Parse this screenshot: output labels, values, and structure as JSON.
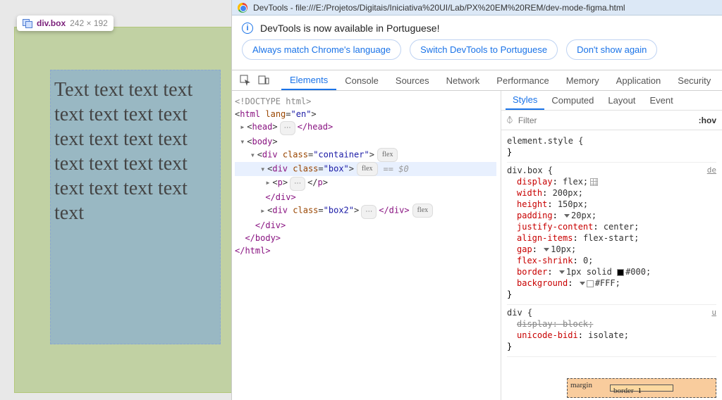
{
  "tooltip": {
    "selector": "div.box",
    "dimensions": "242 × 192"
  },
  "page_text": "Text text text text text text text text text text text text text text text text text text text text text",
  "devtools": {
    "title": "DevTools - file:///E:/Projetos/Digitais/Iniciativa%20UI/Lab/PX%20EM%20REM/dev-mode-figma.html",
    "info_message": "DevTools is now available in Portuguese!",
    "buttons": {
      "match": "Always match Chrome's language",
      "switch": "Switch DevTools to Portuguese",
      "dont": "Don't show again"
    },
    "tabs": [
      "Elements",
      "Console",
      "Sources",
      "Network",
      "Performance",
      "Memory",
      "Application",
      "Security"
    ],
    "dom": {
      "doctype": "<!DOCTYPE html>",
      "html_open": "html",
      "lang_attr": "lang",
      "lang_val": "\"en\"",
      "head": "head",
      "body": "body",
      "div": "div",
      "class_attr": "class",
      "container_val": "\"container\"",
      "box_val": "\"box\"",
      "box2_val": "\"box2\"",
      "p": "p",
      "flex_badge": "flex",
      "close_head": "</head>",
      "close_div": "</div>",
      "close_body": "</body>",
      "close_html": "</html>",
      "dollar": "== $0"
    },
    "styles": {
      "subtabs": [
        "Styles",
        "Computed",
        "Layout",
        "Event"
      ],
      "filter_placeholder": "Filter",
      "hov": ":hov",
      "element_style": "element.style {",
      "brace_close": "}",
      "selector_box": "div.box {",
      "link": "de",
      "props": {
        "display": "display",
        "display_v": "flex;",
        "width": "width",
        "width_v": "200px;",
        "height": "height",
        "height_v": "150px;",
        "padding": "padding",
        "padding_v": "20px;",
        "jc": "justify-content",
        "jc_v": "center;",
        "ai": "align-items",
        "ai_v": "flex-start;",
        "gap": "gap",
        "gap_v": "10px;",
        "fs": "flex-shrink",
        "fs_v": "0;",
        "border": "border",
        "border_v": "1px solid",
        "border_c": "#000;",
        "bg": "background",
        "bg_c": "#FFF;"
      },
      "div_sel": "div {",
      "display_block": "display",
      "display_block_v": "block;",
      "ub": "unicode-bidi",
      "ub_v": "isolate;",
      "ua_link": "u"
    },
    "boxmodel": {
      "margin": "margin",
      "border": "border",
      "border_val": "1",
      "dash": "-"
    }
  }
}
